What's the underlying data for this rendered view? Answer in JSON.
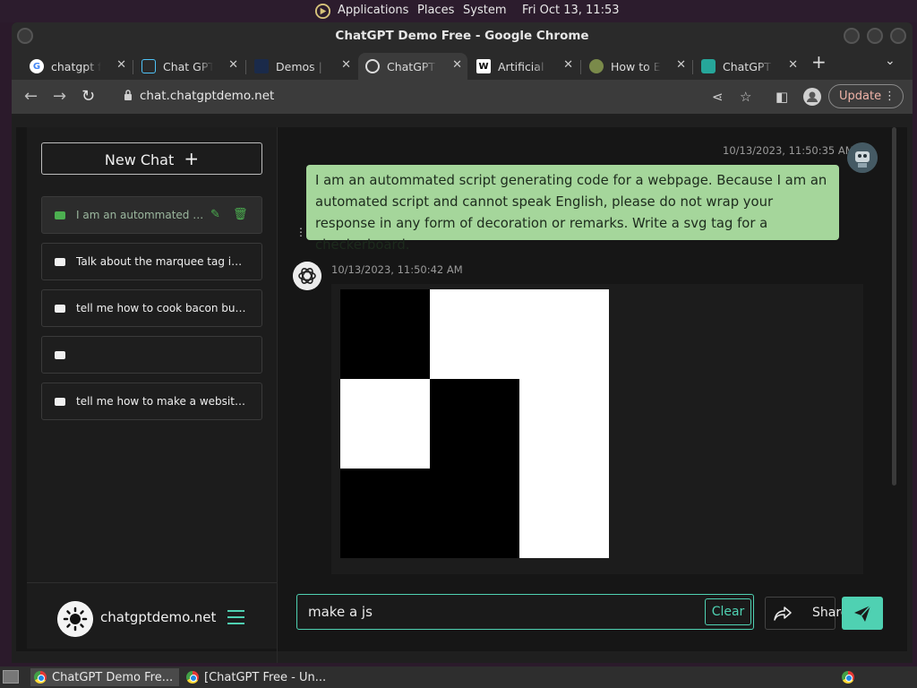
{
  "desktop": {
    "menu": [
      "Applications",
      "Places",
      "System"
    ],
    "clock": "Fri Oct 13, 11:53"
  },
  "window": {
    "title": "ChatGPT Demo Free - Google Chrome"
  },
  "tabs": [
    {
      "label": "chatgpt free",
      "icon": "google-icon",
      "active": false
    },
    {
      "label": "Chat GPT Online",
      "icon": "chat-icon",
      "active": false
    },
    {
      "label": "Demos | Inflection",
      "icon": "demos-icon",
      "active": false
    },
    {
      "label": "ChatGPT Demo",
      "icon": "globe-icon",
      "active": true
    },
    {
      "label": "Artificial intelligence",
      "icon": "wikipedia-icon",
      "active": false
    },
    {
      "label": "How to Enable",
      "icon": "howto-icon",
      "active": false
    },
    {
      "label": "ChatGPT Free",
      "icon": "openai-icon",
      "active": false
    }
  ],
  "address": {
    "url": "chat.chatgptdemo.net",
    "update_label": "Update"
  },
  "sidebar": {
    "new_chat_label": "New Chat",
    "chats": [
      {
        "label": "I am an autommated script generating code for a webpage",
        "active": true
      },
      {
        "label": "Talk about the marquee tag in great detail",
        "active": false
      },
      {
        "label": "tell me how to cook bacon but write it in html",
        "active": false
      },
      {
        "label": "",
        "active": false
      },
      {
        "label": "tell me how to make a website but in html",
        "active": false
      }
    ],
    "site_name": "chatgptdemo.net"
  },
  "conversation": {
    "user_timestamp": "10/13/2023, 11:50:35 AM",
    "user_message": "I am an autommated script generating code for a webpage. Because I am an automated script and cannot speak English, please do not wrap your response in any form of decoration or remarks. Write a svg tag for a checkerboard.",
    "bot_timestamp": "10/13/2023, 11:50:42 AM",
    "checkerboard": [
      [
        "black",
        "white",
        "white"
      ],
      [
        "white",
        "black",
        "white"
      ],
      [
        "black",
        "black",
        "white"
      ]
    ]
  },
  "composer": {
    "input_value": "make a js",
    "clear_label": "Clear",
    "share_label": "Share"
  },
  "taskbar": {
    "items": [
      "ChatGPT Demo Fre...",
      "[ChatGPT Free - Un..."
    ]
  },
  "colors": {
    "accent": "#4fd1b2",
    "user_bubble": "#a5d69b"
  }
}
